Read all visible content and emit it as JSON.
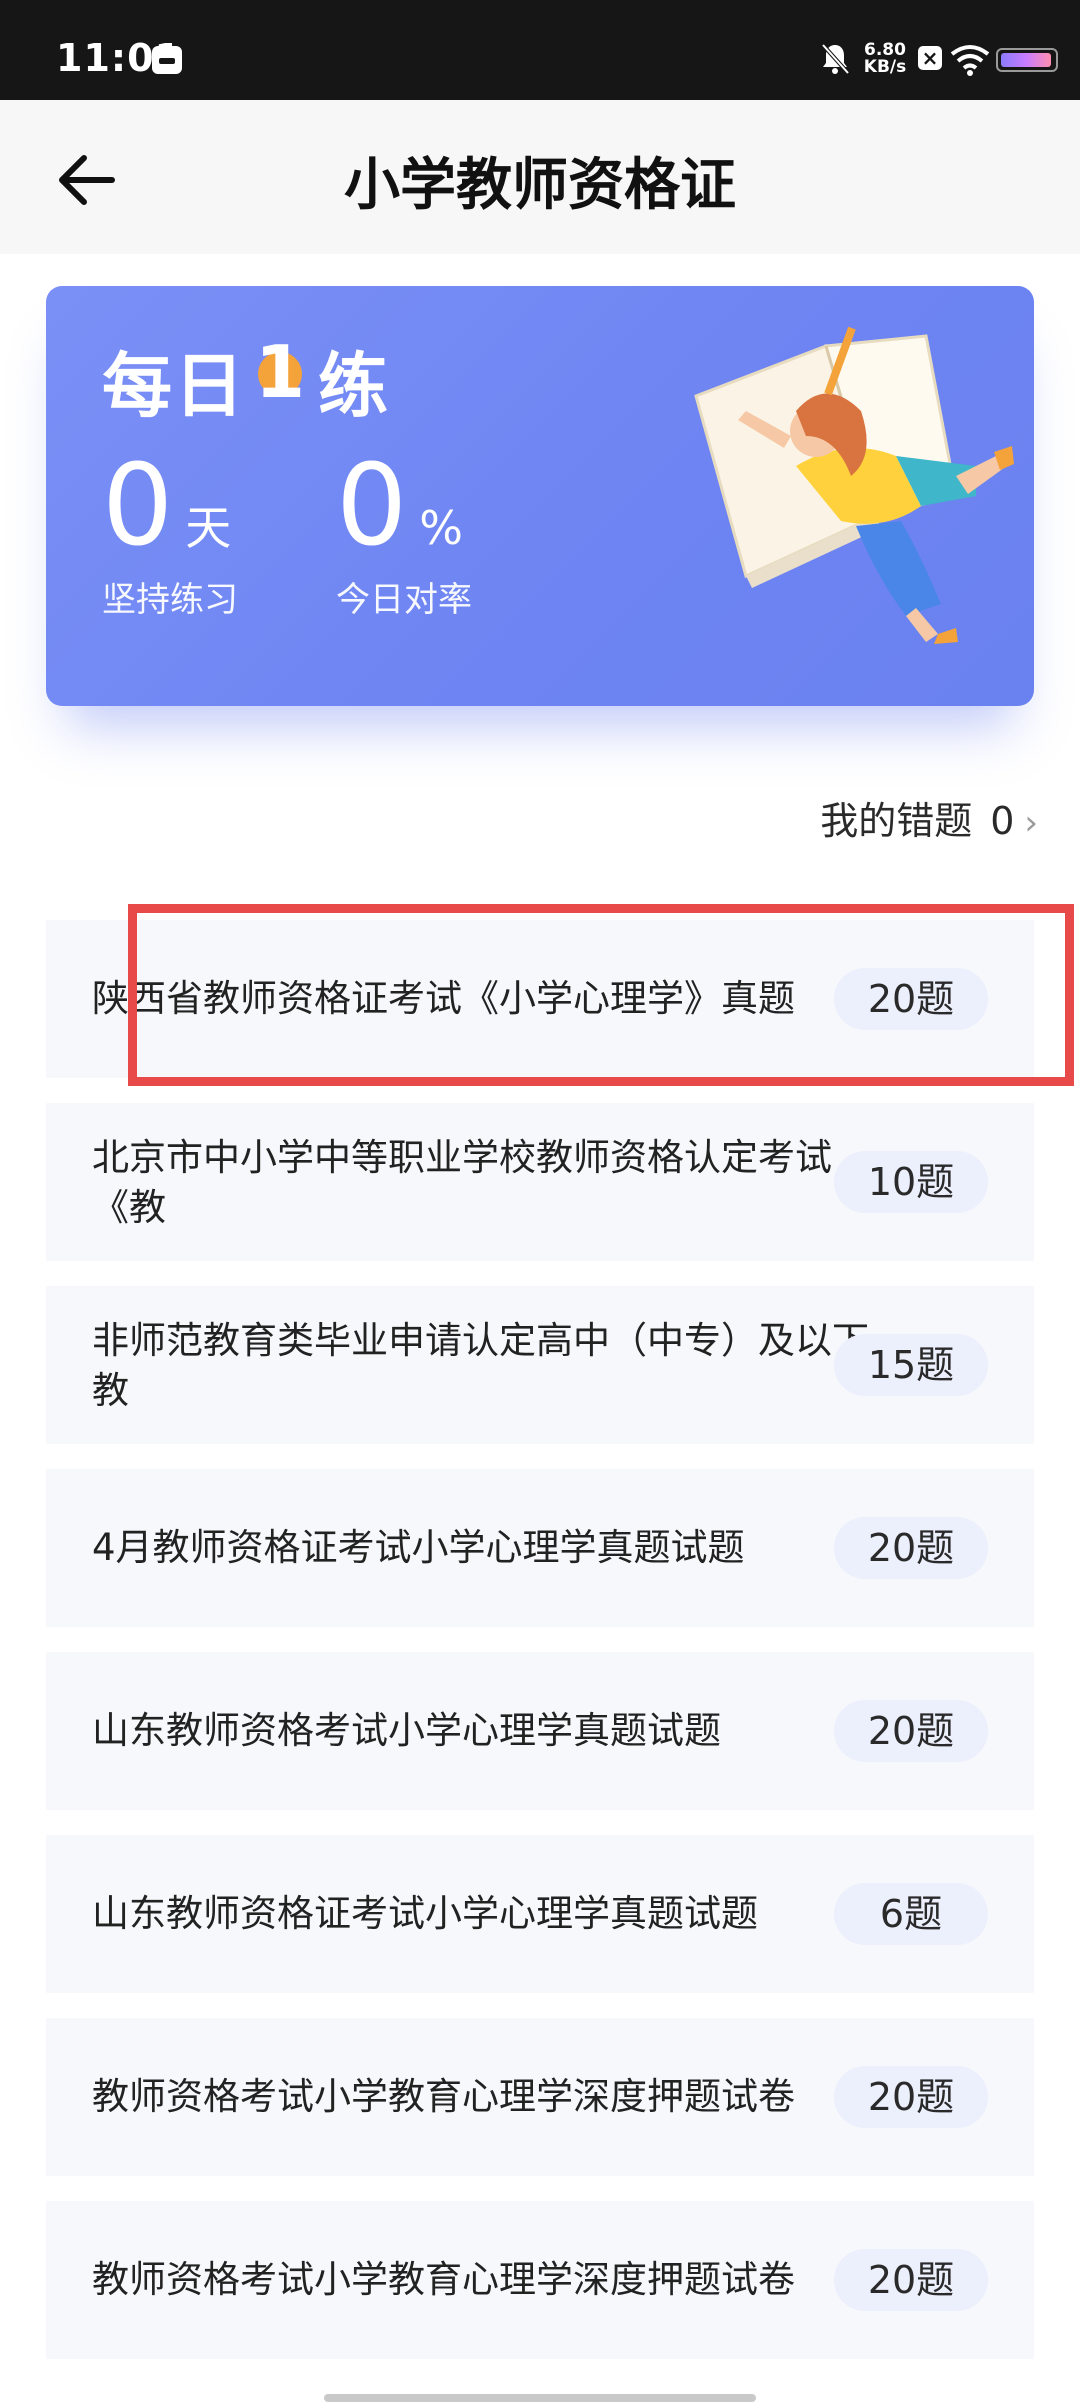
{
  "status_bar": {
    "time": "11:01",
    "net_speed_value": "6.80",
    "net_speed_unit": "KB/s",
    "icons": [
      "calendar-icon",
      "mute-bell-icon",
      "close-box-icon",
      "wifi-icon",
      "battery-icon"
    ]
  },
  "header": {
    "title": "小学教师资格证",
    "back_icon": "arrow-left-icon"
  },
  "banner": {
    "title_prefix": "每日",
    "title_number": "1",
    "title_suffix": "练",
    "stats": [
      {
        "value": "0",
        "unit": "天",
        "label": "坚持练习"
      },
      {
        "value": "0",
        "unit": "%",
        "label": "今日对率"
      }
    ],
    "colors": {
      "background": "#6d84f2",
      "accent": "#f4a23a"
    }
  },
  "mistakes": {
    "label": "我的错题",
    "count": "0"
  },
  "list": {
    "items": [
      {
        "title": "陕西省教师资格证考试《小学心理学》真题",
        "count": "20题"
      },
      {
        "title": "北京市中小学中等职业学校教师资格认定考试《教\n育心理学》试卷",
        "count": "10题"
      },
      {
        "title": "非师范教育类毕业申请认定高中（中专）及以下教\n师资格考试试卷教育心理学（小学）试题卷",
        "count": "15题"
      },
      {
        "title": "4月教师资格证考试小学心理学真题试题",
        "count": "20题"
      },
      {
        "title": "山东教师资格考试小学心理学真题试题",
        "count": "20题"
      },
      {
        "title": "山东教师资格证考试小学心理学真题试题",
        "count": "6题"
      },
      {
        "title": "教师资格考试小学教育心理学深度押题试卷",
        "count": "20题"
      },
      {
        "title": "教师资格考试小学教育心理学深度押题试卷",
        "count": "20题"
      }
    ]
  },
  "highlight_color": "#e84a4a"
}
